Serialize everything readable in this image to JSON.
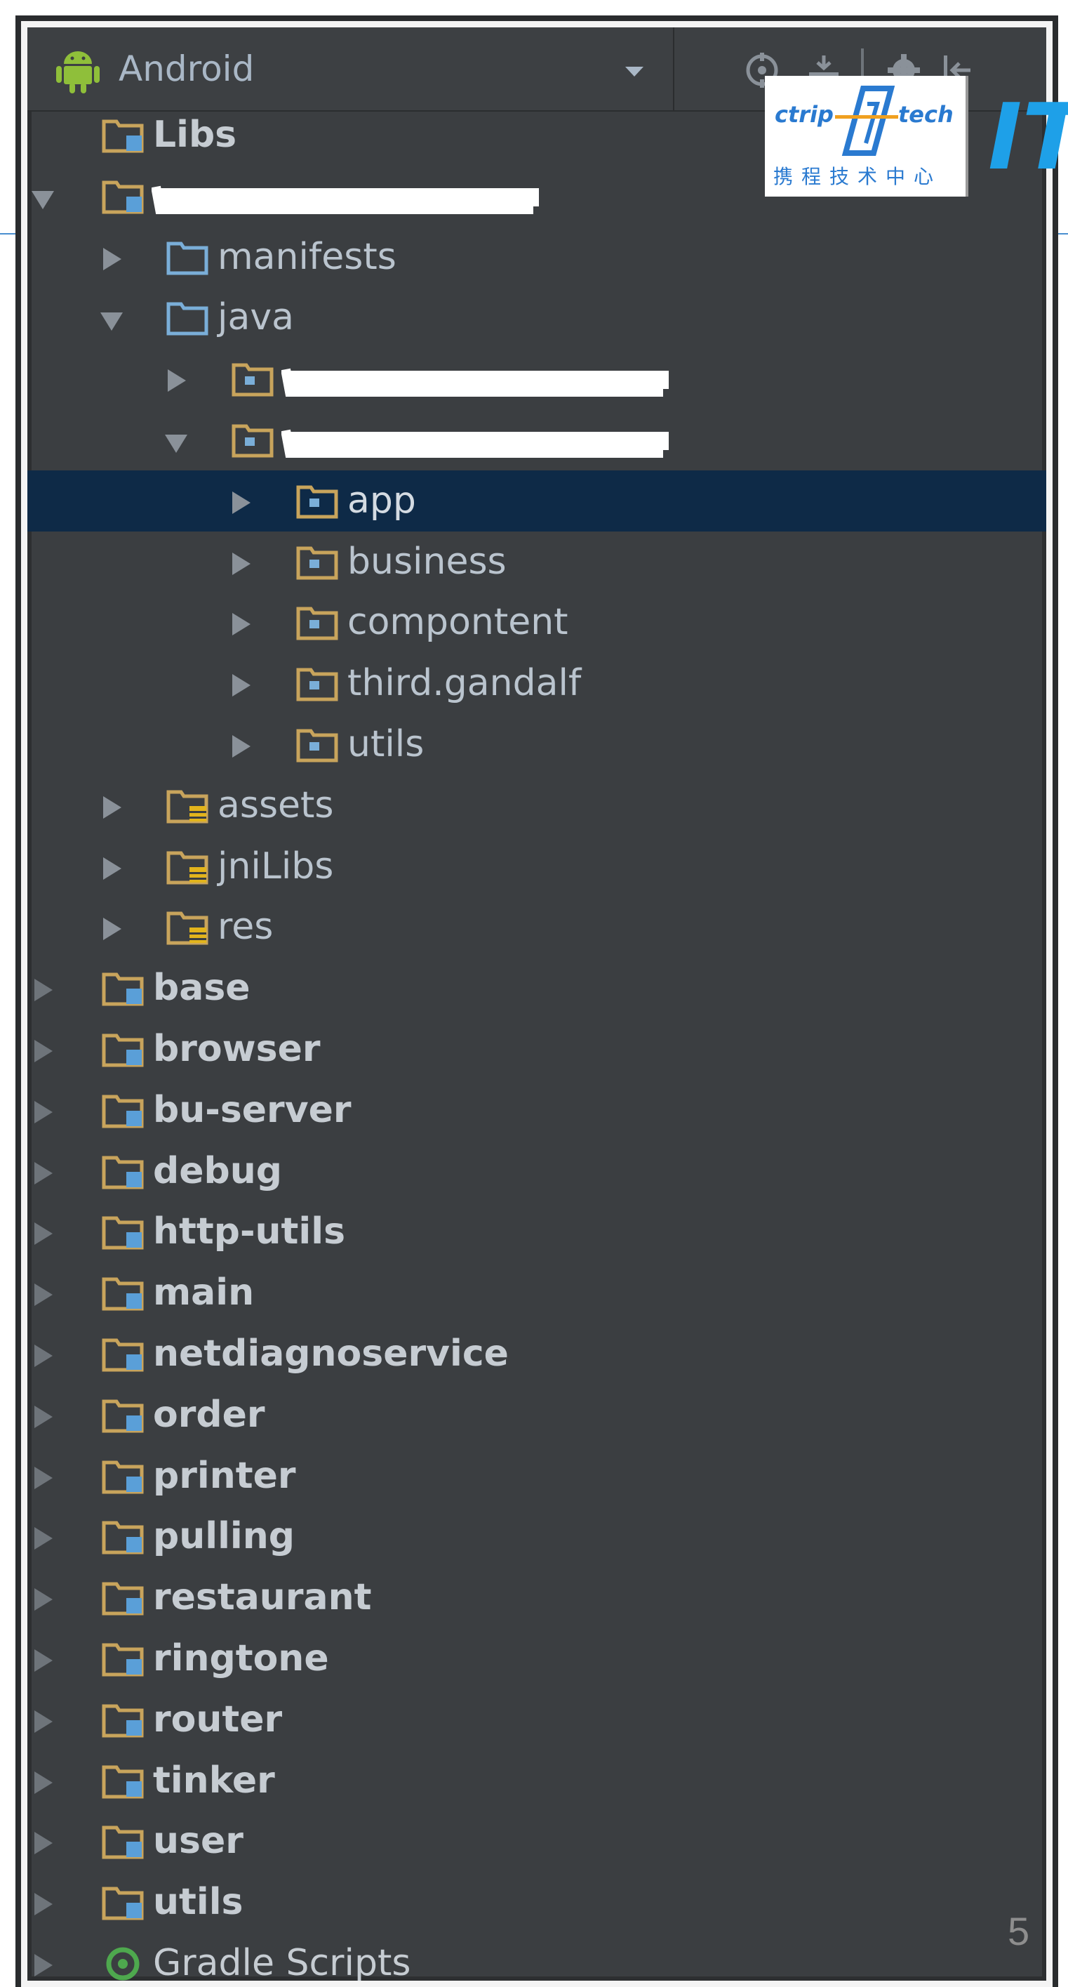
{
  "toolbar": {
    "view_label": "Android",
    "icons": [
      "android-icon",
      "dropdown-icon",
      "target-icon",
      "collapse-icon",
      "gear-icon",
      "hide-icon"
    ]
  },
  "logo": {
    "ctrip": "ctrip",
    "tech": "tech",
    "cn": "携程技术中心",
    "it": "IT"
  },
  "tree": {
    "rows": [
      {
        "label": "Libs",
        "type": "module"
      },
      {
        "label": "",
        "type": "module",
        "redacted": true
      },
      {
        "label": "manifests",
        "type": "folder"
      },
      {
        "label": "java",
        "type": "folder"
      },
      {
        "label": "",
        "type": "package",
        "redacted": true
      },
      {
        "label": "",
        "type": "package",
        "redacted": true
      },
      {
        "label": "app",
        "type": "package",
        "selected": true
      },
      {
        "label": "business",
        "type": "package"
      },
      {
        "label": "compontent",
        "type": "package"
      },
      {
        "label": "third.gandalf",
        "type": "package"
      },
      {
        "label": "utils",
        "type": "package"
      },
      {
        "label": "assets",
        "type": "resource"
      },
      {
        "label": "jniLibs",
        "type": "resource"
      },
      {
        "label": "res",
        "type": "resource"
      },
      {
        "label": "base",
        "type": "module"
      },
      {
        "label": "browser",
        "type": "module"
      },
      {
        "label": "bu-server",
        "type": "module"
      },
      {
        "label": "debug",
        "type": "module"
      },
      {
        "label": "http-utils",
        "type": "module"
      },
      {
        "label": "main",
        "type": "module"
      },
      {
        "label": "netdiagnoservice",
        "type": "module"
      },
      {
        "label": "order",
        "type": "module"
      },
      {
        "label": "printer",
        "type": "module"
      },
      {
        "label": "pulling",
        "type": "module"
      },
      {
        "label": "restaurant",
        "type": "module"
      },
      {
        "label": "ringtone",
        "type": "module"
      },
      {
        "label": "router",
        "type": "module"
      },
      {
        "label": "tinker",
        "type": "module"
      },
      {
        "label": "user",
        "type": "module"
      },
      {
        "label": "utils",
        "type": "module"
      },
      {
        "label": "Gradle Scripts",
        "type": "gradle"
      }
    ]
  },
  "page_number": "5",
  "colors": {
    "panel_bg": "#3b3e41",
    "selected_bg": "#0e2a47",
    "folder_orange": "#c8a45c",
    "folder_blue": "#7aaed8",
    "accent_blue": "#1ea0e8"
  }
}
